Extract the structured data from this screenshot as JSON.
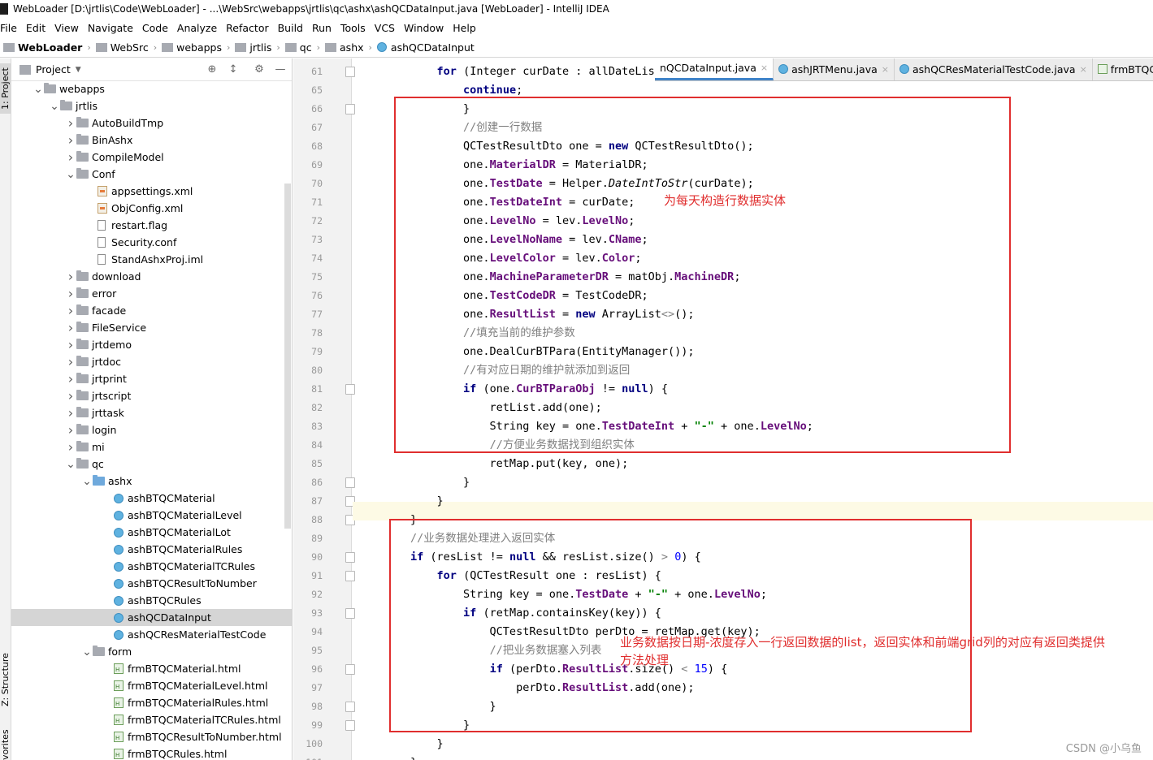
{
  "title_bar": {
    "text": "WebLoader [D:\\jrtlis\\Code\\WebLoader] - ...\\WebSrc\\webapps\\jrtlis\\qc\\ashx\\ashQCDataInput.java [WebLoader] - IntelliJ IDEA"
  },
  "menu": [
    "File",
    "Edit",
    "View",
    "Navigate",
    "Code",
    "Analyze",
    "Refactor",
    "Build",
    "Run",
    "Tools",
    "VCS",
    "Window",
    "Help"
  ],
  "breadcrumb": [
    "WebLoader",
    "WebSrc",
    "webapps",
    "jrtlis",
    "qc",
    "ashx",
    "ashQCDataInput"
  ],
  "left_strip": {
    "project": "1: Project",
    "structure": "Z: Structure",
    "favorites": "vorites"
  },
  "project_panel": {
    "title": "Project"
  },
  "tree": [
    {
      "label": "webapps",
      "depth": 2,
      "arrow": "down",
      "icon": "folder"
    },
    {
      "label": "jrtlis",
      "depth": 3,
      "arrow": "down",
      "icon": "folder"
    },
    {
      "label": "AutoBuildTmp",
      "depth": 4,
      "arrow": "right",
      "icon": "folder"
    },
    {
      "label": "BinAshx",
      "depth": 4,
      "arrow": "right",
      "icon": "folder"
    },
    {
      "label": "CompileModel",
      "depth": 4,
      "arrow": "right",
      "icon": "folder"
    },
    {
      "label": "Conf",
      "depth": 4,
      "arrow": "down",
      "icon": "folder"
    },
    {
      "label": "appsettings.xml",
      "depth": 5,
      "arrow": "",
      "icon": "xml"
    },
    {
      "label": "ObjConfig.xml",
      "depth": 5,
      "arrow": "",
      "icon": "xml"
    },
    {
      "label": "restart.flag",
      "depth": 5,
      "arrow": "",
      "icon": "txt"
    },
    {
      "label": "Security.conf",
      "depth": 5,
      "arrow": "",
      "icon": "txt"
    },
    {
      "label": "StandAshxProj.iml",
      "depth": 5,
      "arrow": "",
      "icon": "txt"
    },
    {
      "label": "download",
      "depth": 4,
      "arrow": "right",
      "icon": "folder"
    },
    {
      "label": "error",
      "depth": 4,
      "arrow": "right",
      "icon": "folder"
    },
    {
      "label": "facade",
      "depth": 4,
      "arrow": "right",
      "icon": "folder"
    },
    {
      "label": "FileService",
      "depth": 4,
      "arrow": "right",
      "icon": "folder"
    },
    {
      "label": "jrtdemo",
      "depth": 4,
      "arrow": "right",
      "icon": "folder"
    },
    {
      "label": "jrtdoc",
      "depth": 4,
      "arrow": "right",
      "icon": "folder"
    },
    {
      "label": "jrtprint",
      "depth": 4,
      "arrow": "right",
      "icon": "folder"
    },
    {
      "label": "jrtscript",
      "depth": 4,
      "arrow": "right",
      "icon": "folder"
    },
    {
      "label": "jrttask",
      "depth": 4,
      "arrow": "right",
      "icon": "folder"
    },
    {
      "label": "login",
      "depth": 4,
      "arrow": "right",
      "icon": "folder"
    },
    {
      "label": "mi",
      "depth": 4,
      "arrow": "right",
      "icon": "folder"
    },
    {
      "label": "qc",
      "depth": 4,
      "arrow": "down",
      "icon": "folder"
    },
    {
      "label": "ashx",
      "depth": 5,
      "arrow": "down",
      "icon": "bluefolder"
    },
    {
      "label": "ashBTQCMaterial",
      "depth": 6,
      "arrow": "",
      "icon": "java"
    },
    {
      "label": "ashBTQCMaterialLevel",
      "depth": 6,
      "arrow": "",
      "icon": "java"
    },
    {
      "label": "ashBTQCMaterialLot",
      "depth": 6,
      "arrow": "",
      "icon": "java"
    },
    {
      "label": "ashBTQCMaterialRules",
      "depth": 6,
      "arrow": "",
      "icon": "java"
    },
    {
      "label": "ashBTQCMaterialTCRules",
      "depth": 6,
      "arrow": "",
      "icon": "java"
    },
    {
      "label": "ashBTQCResultToNumber",
      "depth": 6,
      "arrow": "",
      "icon": "java"
    },
    {
      "label": "ashBTQCRules",
      "depth": 6,
      "arrow": "",
      "icon": "java"
    },
    {
      "label": "ashQCDataInput",
      "depth": 6,
      "arrow": "",
      "icon": "java",
      "selected": true
    },
    {
      "label": "ashQCResMaterialTestCode",
      "depth": 6,
      "arrow": "",
      "icon": "java"
    },
    {
      "label": "form",
      "depth": 5,
      "arrow": "down",
      "icon": "folder"
    },
    {
      "label": "frmBTQCMaterial.html",
      "depth": 6,
      "arrow": "",
      "icon": "html"
    },
    {
      "label": "frmBTQCMaterialLevel.html",
      "depth": 6,
      "arrow": "",
      "icon": "html"
    },
    {
      "label": "frmBTQCMaterialRules.html",
      "depth": 6,
      "arrow": "",
      "icon": "html"
    },
    {
      "label": "frmBTQCMaterialTCRules.html",
      "depth": 6,
      "arrow": "",
      "icon": "html"
    },
    {
      "label": "frmBTQCResultToNumber.html",
      "depth": 6,
      "arrow": "",
      "icon": "html"
    },
    {
      "label": "frmBTQCRules.html",
      "depth": 6,
      "arrow": "",
      "icon": "html"
    }
  ],
  "tabs": [
    {
      "label": "nQCDataInput.java",
      "icon": "java",
      "active": true
    },
    {
      "label": "ashJRTMenu.java",
      "icon": "java",
      "active": false
    },
    {
      "label": "ashQCResMaterialTestCode.java",
      "icon": "java",
      "active": false
    },
    {
      "label": "frmBTQCMa",
      "icon": "html",
      "active": false
    }
  ],
  "code_lines": [
    {
      "n": "61",
      "fold": true,
      "tokens": [
        [
          "            ",
          ""
        ],
        [
          "for",
          "kw"
        ],
        [
          " (Integer curDate : allDateList) ",
          ""
        ],
        [
          "{",
          ""
        ]
      ]
    },
    {
      "n": "65",
      "fold": false,
      "tokens": [
        [
          "                ",
          ""
        ],
        [
          "continue",
          "kw"
        ],
        [
          ";",
          ""
        ]
      ]
    },
    {
      "n": "66",
      "fold": true,
      "tokens": [
        [
          "                }",
          ""
        ]
      ]
    },
    {
      "n": "67",
      "fold": false,
      "tokens": [
        [
          "                ",
          ""
        ],
        [
          "//创建一行数据",
          "cm"
        ]
      ]
    },
    {
      "n": "68",
      "fold": false,
      "tokens": [
        [
          "                QCTestResultDto one = ",
          ""
        ],
        [
          "new",
          "kw"
        ],
        [
          " QCTestResultDto();",
          ""
        ]
      ]
    },
    {
      "n": "69",
      "fold": false,
      "tokens": [
        [
          "                one.",
          ""
        ],
        [
          "MaterialDR",
          "fld"
        ],
        [
          " = MaterialDR;",
          ""
        ]
      ]
    },
    {
      "n": "70",
      "fold": false,
      "tokens": [
        [
          "                one.",
          ""
        ],
        [
          "TestDate",
          "fld"
        ],
        [
          " = Helper.",
          ""
        ],
        [
          "DateIntToStr",
          "it"
        ],
        [
          "(curDate);",
          ""
        ]
      ]
    },
    {
      "n": "71",
      "fold": false,
      "tokens": [
        [
          "                one.",
          ""
        ],
        [
          "TestDateInt",
          "fld"
        ],
        [
          " = curDate;",
          ""
        ]
      ]
    },
    {
      "n": "72",
      "fold": false,
      "tokens": [
        [
          "                one.",
          ""
        ],
        [
          "LevelNo",
          "fld"
        ],
        [
          " = lev.",
          ""
        ],
        [
          "LevelNo",
          "fld"
        ],
        [
          ";",
          ""
        ]
      ]
    },
    {
      "n": "73",
      "fold": false,
      "tokens": [
        [
          "                one.",
          ""
        ],
        [
          "LevelNoName",
          "fld"
        ],
        [
          " = lev.",
          ""
        ],
        [
          "CName",
          "fld"
        ],
        [
          ";",
          ""
        ]
      ]
    },
    {
      "n": "74",
      "fold": false,
      "tokens": [
        [
          "                one.",
          ""
        ],
        [
          "LevelColor",
          "fld"
        ],
        [
          " = lev.",
          ""
        ],
        [
          "Color",
          "fld"
        ],
        [
          ";",
          ""
        ]
      ]
    },
    {
      "n": "75",
      "fold": false,
      "tokens": [
        [
          "                one.",
          ""
        ],
        [
          "MachineParameterDR",
          "fld"
        ],
        [
          " = matObj.",
          ""
        ],
        [
          "MachineDR",
          "fld"
        ],
        [
          ";",
          ""
        ]
      ]
    },
    {
      "n": "76",
      "fold": false,
      "tokens": [
        [
          "                one.",
          ""
        ],
        [
          "TestCodeDR",
          "fld"
        ],
        [
          " = TestCodeDR;",
          ""
        ]
      ]
    },
    {
      "n": "77",
      "fold": false,
      "tokens": [
        [
          "                one.",
          ""
        ],
        [
          "ResultList",
          "fld"
        ],
        [
          " = ",
          ""
        ],
        [
          "new",
          "kw"
        ],
        [
          " ArrayList",
          ""
        ],
        [
          "<>",
          "gr"
        ],
        [
          "();",
          ""
        ]
      ]
    },
    {
      "n": "78",
      "fold": false,
      "tokens": [
        [
          "                ",
          ""
        ],
        [
          "//填充当前的维护参数",
          "cm"
        ]
      ]
    },
    {
      "n": "79",
      "fold": false,
      "tokens": [
        [
          "                one.DealCurBTPara(EntityManager());",
          ""
        ]
      ]
    },
    {
      "n": "80",
      "fold": false,
      "tokens": [
        [
          "                ",
          ""
        ],
        [
          "//有对应日期的维护就添加到返回",
          "cm"
        ]
      ]
    },
    {
      "n": "81",
      "fold": true,
      "tokens": [
        [
          "                ",
          ""
        ],
        [
          "if",
          "kw"
        ],
        [
          " (one.",
          ""
        ],
        [
          "CurBTParaObj",
          "fld"
        ],
        [
          " != ",
          ""
        ],
        [
          "null",
          "kw"
        ],
        [
          ") {",
          ""
        ]
      ]
    },
    {
      "n": "82",
      "fold": false,
      "tokens": [
        [
          "                    retList.add(one);",
          ""
        ]
      ]
    },
    {
      "n": "83",
      "fold": false,
      "tokens": [
        [
          "                    String key = one.",
          ""
        ],
        [
          "TestDateInt",
          "fld"
        ],
        [
          " + ",
          ""
        ],
        [
          "\"-\"",
          "st"
        ],
        [
          " + one.",
          ""
        ],
        [
          "LevelNo",
          "fld"
        ],
        [
          ";",
          ""
        ]
      ]
    },
    {
      "n": "84",
      "fold": false,
      "tokens": [
        [
          "                    ",
          ""
        ],
        [
          "//方便业务数据找到组织实体",
          "cm"
        ]
      ]
    },
    {
      "n": "85",
      "fold": false,
      "tokens": [
        [
          "                    retMap.put(key, one);",
          ""
        ]
      ]
    },
    {
      "n": "86",
      "fold": true,
      "tokens": [
        [
          "                }",
          ""
        ]
      ]
    },
    {
      "n": "87",
      "fold": true,
      "tokens": [
        [
          "            }",
          ""
        ]
      ]
    },
    {
      "n": "88",
      "fold": true,
      "tokens": [
        [
          "        }",
          ""
        ]
      ]
    },
    {
      "n": "89",
      "fold": false,
      "tokens": [
        [
          "        ",
          ""
        ],
        [
          "//业务数据处理进入返回实体",
          "cm"
        ]
      ]
    },
    {
      "n": "90",
      "fold": true,
      "tokens": [
        [
          "        ",
          ""
        ],
        [
          "if",
          "kw"
        ],
        [
          " (resList != ",
          ""
        ],
        [
          "null",
          "kw"
        ],
        [
          " && resList.size() ",
          ""
        ],
        [
          ">",
          "gr"
        ],
        [
          " ",
          ""
        ],
        [
          "0",
          "num"
        ],
        [
          ") {",
          ""
        ]
      ]
    },
    {
      "n": "91",
      "fold": true,
      "tokens": [
        [
          "            ",
          ""
        ],
        [
          "for",
          "kw"
        ],
        [
          " (QCTestResult one : resList) {",
          ""
        ]
      ]
    },
    {
      "n": "92",
      "fold": false,
      "tokens": [
        [
          "                String key = one.",
          ""
        ],
        [
          "TestDate",
          "fld"
        ],
        [
          " + ",
          ""
        ],
        [
          "\"-\"",
          "st"
        ],
        [
          " + one.",
          ""
        ],
        [
          "LevelNo",
          "fld"
        ],
        [
          ";",
          ""
        ]
      ]
    },
    {
      "n": "93",
      "fold": true,
      "tokens": [
        [
          "                ",
          ""
        ],
        [
          "if",
          "kw"
        ],
        [
          " (retMap.containsKey(key)) {",
          ""
        ]
      ]
    },
    {
      "n": "94",
      "fold": false,
      "tokens": [
        [
          "                    QCTestResultDto perDto = retMap.get(key);",
          ""
        ]
      ]
    },
    {
      "n": "95",
      "fold": false,
      "tokens": [
        [
          "                    ",
          ""
        ],
        [
          "//把业务数据塞入列表",
          "cm"
        ]
      ]
    },
    {
      "n": "96",
      "fold": true,
      "tokens": [
        [
          "                    ",
          ""
        ],
        [
          "if",
          "kw"
        ],
        [
          " (perDto.",
          ""
        ],
        [
          "ResultList",
          "fld"
        ],
        [
          ".size() ",
          ""
        ],
        [
          "<",
          "gr"
        ],
        [
          " ",
          ""
        ],
        [
          "15",
          "num"
        ],
        [
          ") {",
          ""
        ]
      ]
    },
    {
      "n": "97",
      "fold": false,
      "tokens": [
        [
          "                        perDto.",
          ""
        ],
        [
          "ResultList",
          "fld"
        ],
        [
          ".add(one);",
          ""
        ]
      ]
    },
    {
      "n": "98",
      "fold": true,
      "tokens": [
        [
          "                    }",
          ""
        ]
      ]
    },
    {
      "n": "99",
      "fold": true,
      "tokens": [
        [
          "                }",
          ""
        ]
      ]
    },
    {
      "n": "100",
      "fold": false,
      "tokens": [
        [
          "            }",
          ""
        ]
      ]
    },
    {
      "n": "101",
      "fold": false,
      "tokens": [
        [
          "        }",
          ""
        ]
      ]
    }
  ],
  "annotations": {
    "note1": "为每天构造行数据实体",
    "note2_line1": "业务数据按日期-浓度存入一行返回数据的list，返回实体和前端grid列的对应有返回类提供",
    "note2_line2": "方法处理"
  },
  "watermark": "CSDN @小乌鱼",
  "colors": {
    "keyword": "#000080",
    "field": "#660e7a",
    "comment": "#808080",
    "string": "#008000",
    "number": "#0000ff",
    "annotation": "#e02e2e",
    "selection": "#d5d5d5"
  }
}
